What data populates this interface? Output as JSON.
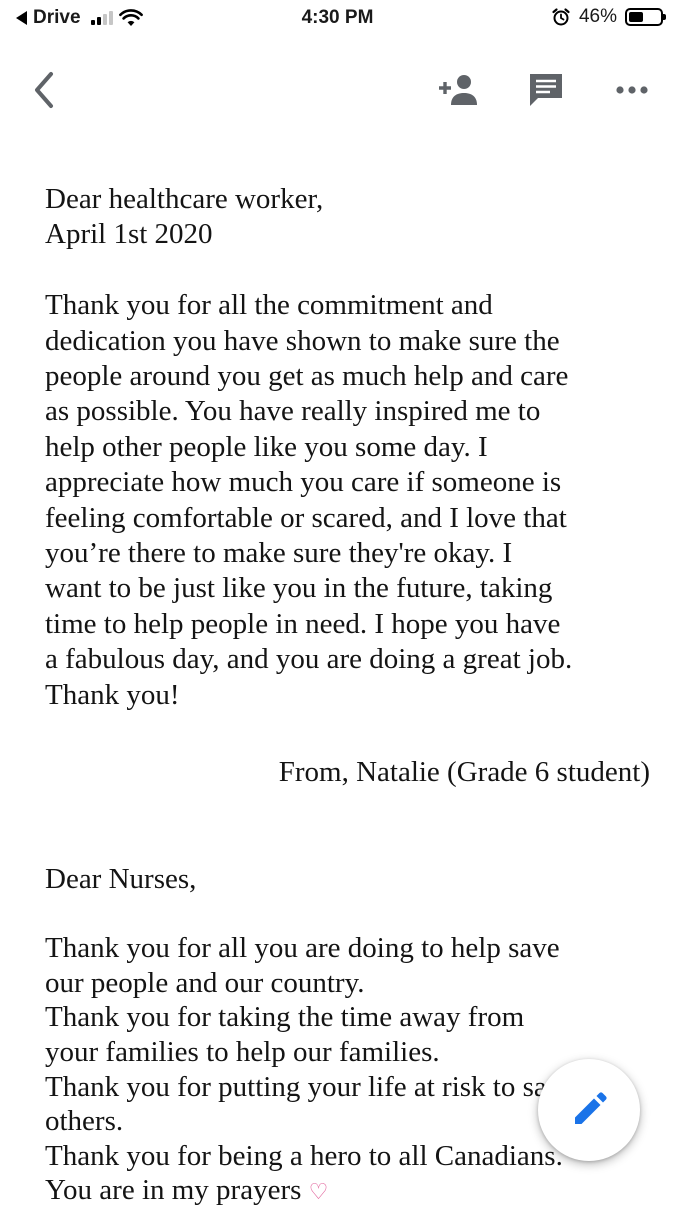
{
  "status_bar": {
    "back_app": "Drive",
    "time": "4:30 PM",
    "battery": "46%",
    "battery_level": 0.46
  },
  "toolbar": {
    "icons": [
      "back-chevron-icon",
      "add-person-icon",
      "comment-icon",
      "more-dots-icon"
    ]
  },
  "letter1": {
    "salutation": "Dear healthcare worker,",
    "date": "April 1st 2020",
    "body": [
      "Thank you for all the commitment and",
      "dedication you have shown to make sure the",
      "people around you get as much help and care",
      "as possible. You have really inspired me to",
      "help other people like you some day. I",
      "appreciate how much you care if someone is",
      "feeling comfortable or scared, and I love that",
      "you’re there to make sure they're okay. I",
      "want to be just like you in the future, taking",
      "time to help people in need. I hope you have",
      "a fabulous day, and you are doing a great job.",
      "Thank you!"
    ],
    "signature": "From, Natalie (Grade 6 student)"
  },
  "letter2": {
    "salutation": "Dear Nurses,",
    "body": [
      "Thank you for all you are doing to help save",
      "our people and our country.",
      "Thank you for taking the time away from",
      "your families to help our families.",
      "Thank you for putting your life at risk to save",
      "others.",
      "Thank you for being a hero to all Canadians.",
      "You are in my prayers"
    ]
  },
  "fab": {
    "icon": "pencil-edit-icon"
  },
  "colors": {
    "accent": "#1a73e8",
    "icon_gray": "#5f6368",
    "heart": "#e1629b"
  }
}
